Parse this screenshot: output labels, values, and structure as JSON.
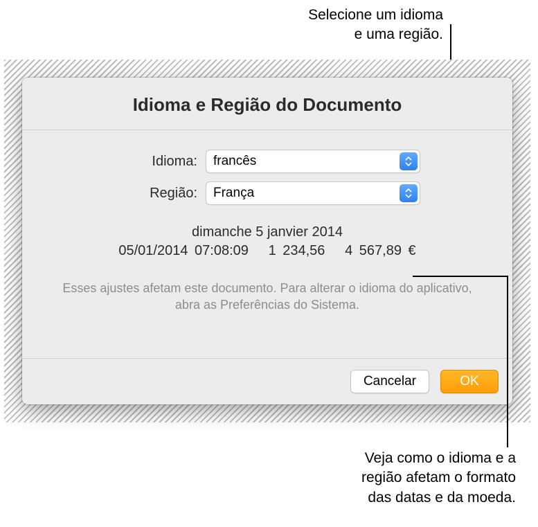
{
  "callouts": {
    "top": "Selecione um idioma\ne uma região.",
    "bottom": "Veja como o idioma e a\nregião afetam o formato\ndas datas e da moeda."
  },
  "dialog": {
    "title": "Idioma e Região do Documento",
    "fields": {
      "language": {
        "label": "Idioma:",
        "value": "francês"
      },
      "region": {
        "label": "Região:",
        "value": "França"
      }
    },
    "preview": {
      "long_date": "dimanche 5 janvier 2014",
      "datetime": "05/01/2014 07:08:09",
      "number": "1 234,56",
      "currency": "4 567,89 €"
    },
    "note": "Esses ajustes afetam este documento. Para alterar o idioma do aplicativo, abra as Preferências do Sistema.",
    "buttons": {
      "cancel": "Cancelar",
      "ok": "OK"
    }
  }
}
